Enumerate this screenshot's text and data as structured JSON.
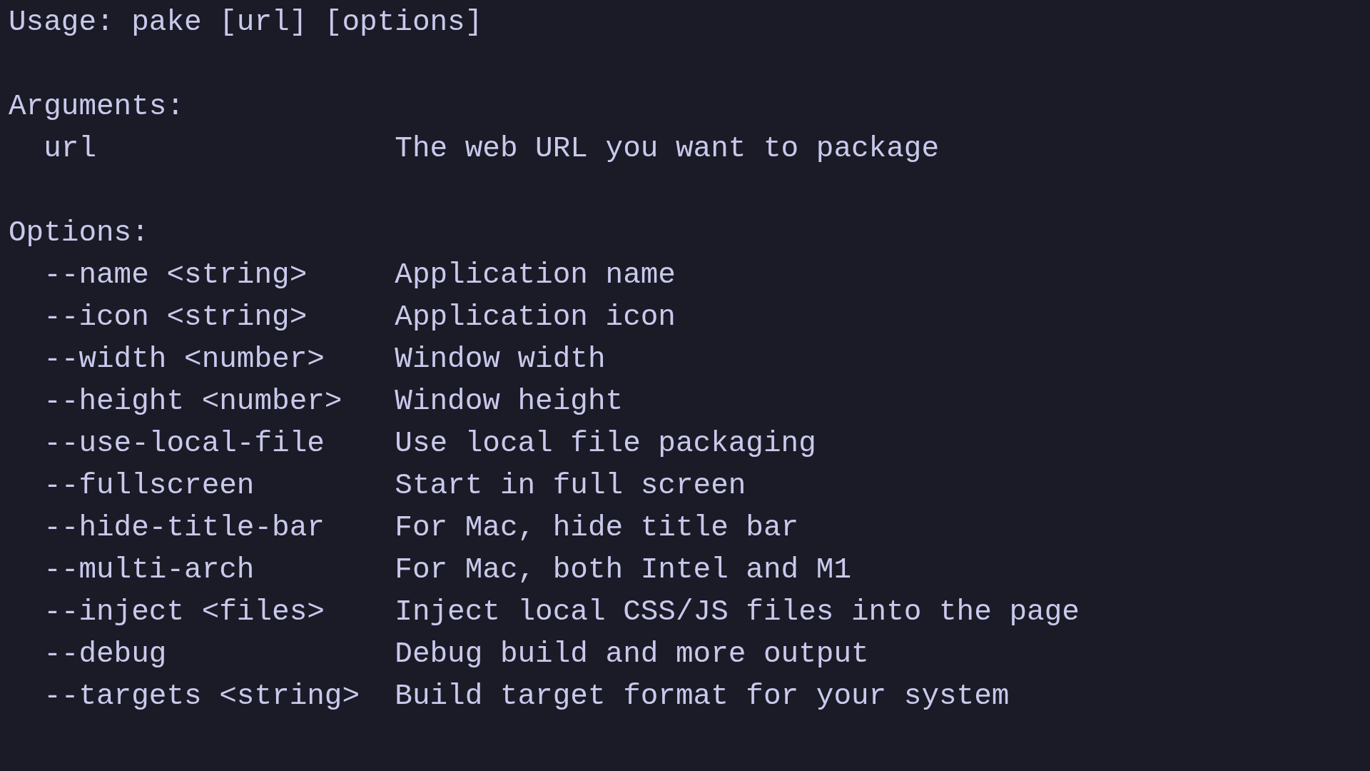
{
  "usage": "Usage: pake [url] [options]",
  "sections": [
    {
      "heading": "Arguments:",
      "entries": [
        {
          "name": "url",
          "description": "The web URL you want to package"
        }
      ]
    },
    {
      "heading": "Options:",
      "entries": [
        {
          "name": "--name <string>",
          "description": "Application name"
        },
        {
          "name": "--icon <string>",
          "description": "Application icon"
        },
        {
          "name": "--width <number>",
          "description": "Window width"
        },
        {
          "name": "--height <number>",
          "description": "Window height"
        },
        {
          "name": "--use-local-file",
          "description": "Use local file packaging"
        },
        {
          "name": "--fullscreen",
          "description": "Start in full screen"
        },
        {
          "name": "--hide-title-bar",
          "description": "For Mac, hide title bar"
        },
        {
          "name": "--multi-arch",
          "description": "For Mac, both Intel and M1"
        },
        {
          "name": "--inject <files>",
          "description": "Inject local CSS/JS files into the page"
        },
        {
          "name": "--debug",
          "description": "Debug build and more output"
        },
        {
          "name": "--targets <string>",
          "description": "Build target format for your system"
        }
      ]
    }
  ]
}
